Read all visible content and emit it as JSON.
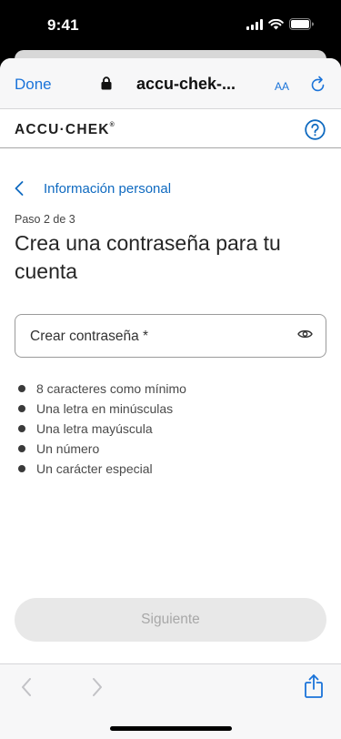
{
  "status_bar": {
    "time": "9:41",
    "icons": [
      "signal-icon",
      "wifi-icon",
      "battery-icon"
    ]
  },
  "browser": {
    "done_label": "Done",
    "url": "accu-chek-...",
    "text_size_label": "AA",
    "icons": [
      "lock-icon",
      "reload-icon"
    ]
  },
  "header": {
    "logo_text": "ACCU·CHEK",
    "logo_mark": "®",
    "help_icon": "question-circle-icon"
  },
  "nav": {
    "back_label": "Información personal",
    "back_icon": "chevron-left-icon"
  },
  "main": {
    "step": "Paso 2 de 3",
    "title": "Crea una contraseña para tu cuenta",
    "password_field": {
      "label": "Crear contraseña *",
      "value": "",
      "icon": "eye-icon"
    },
    "requirements": [
      "8 caracteres como mínimo",
      "Una letra en minúsculas",
      "Una letra mayúscula",
      "Un número",
      "Un carácter especial"
    ],
    "next_button": {
      "label": "Siguiente",
      "disabled": true
    }
  },
  "toolbar": {
    "icons": [
      "back-arrow-icon",
      "forward-arrow-icon",
      "share-icon"
    ]
  },
  "colors": {
    "accent": "#0f6ac0",
    "ios_blue": "#1a73d9",
    "disabled_bg": "#e8e8e8",
    "disabled_text": "#a8a8a8"
  }
}
